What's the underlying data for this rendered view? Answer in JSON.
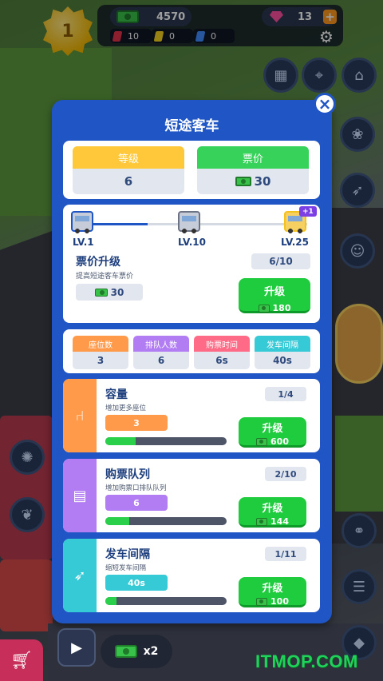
{
  "hud": {
    "level": "1",
    "cash": "4570",
    "gems": "13",
    "plus": "+",
    "resources": [
      {
        "value": "10",
        "color": "#e2334a"
      },
      {
        "value": "0",
        "color": "#f4d21f"
      },
      {
        "value": "0",
        "color": "#3f8cff"
      }
    ]
  },
  "modal": {
    "title": "短途客车",
    "close": "×",
    "level_label": "等级",
    "level_value": "6",
    "ticket_label": "票价",
    "ticket_value": "30",
    "progress": {
      "milestones": [
        "LV.1",
        "LV.10",
        "LV.25"
      ],
      "badge": "+1",
      "fill_fraction": 0.3
    },
    "ticket_upgrade": {
      "title": "票价升级",
      "desc": "提高短途客车票价",
      "current": "30",
      "count": "6/10",
      "button_label": "升级",
      "cost": "180"
    },
    "stats": [
      {
        "label": "座位数",
        "value": "3",
        "color": "#ff9a4a"
      },
      {
        "label": "排队人数",
        "value": "6",
        "color": "#b27cf2"
      },
      {
        "label": "购票时间",
        "value": "6s",
        "color": "#ff6b86"
      },
      {
        "label": "发车间隔",
        "value": "40s",
        "color": "#36c9d6"
      }
    ],
    "upgrades": [
      {
        "title": "容量",
        "desc": "增加更多座位",
        "value": "3",
        "count": "1/4",
        "button_label": "升级",
        "cost": "600",
        "color": "#ff9a4a",
        "progress": 0.25,
        "icon": "seat-icon"
      },
      {
        "title": "购票队列",
        "desc": "增加购票口排队队列",
        "value": "6",
        "count": "2/10",
        "button_label": "升级",
        "cost": "144",
        "color": "#b27cf2",
        "progress": 0.2,
        "icon": "ticket-queue-icon"
      },
      {
        "title": "发车间隔",
        "desc": "缩短发车间隔",
        "value": "40s",
        "count": "1/11",
        "button_label": "升级",
        "cost": "100",
        "color": "#36c9d6",
        "progress": 0.09,
        "icon": "rocket-icon"
      }
    ]
  },
  "bottom": {
    "reward_multiplier": "x2",
    "watermark": "ITMOP.COM"
  }
}
